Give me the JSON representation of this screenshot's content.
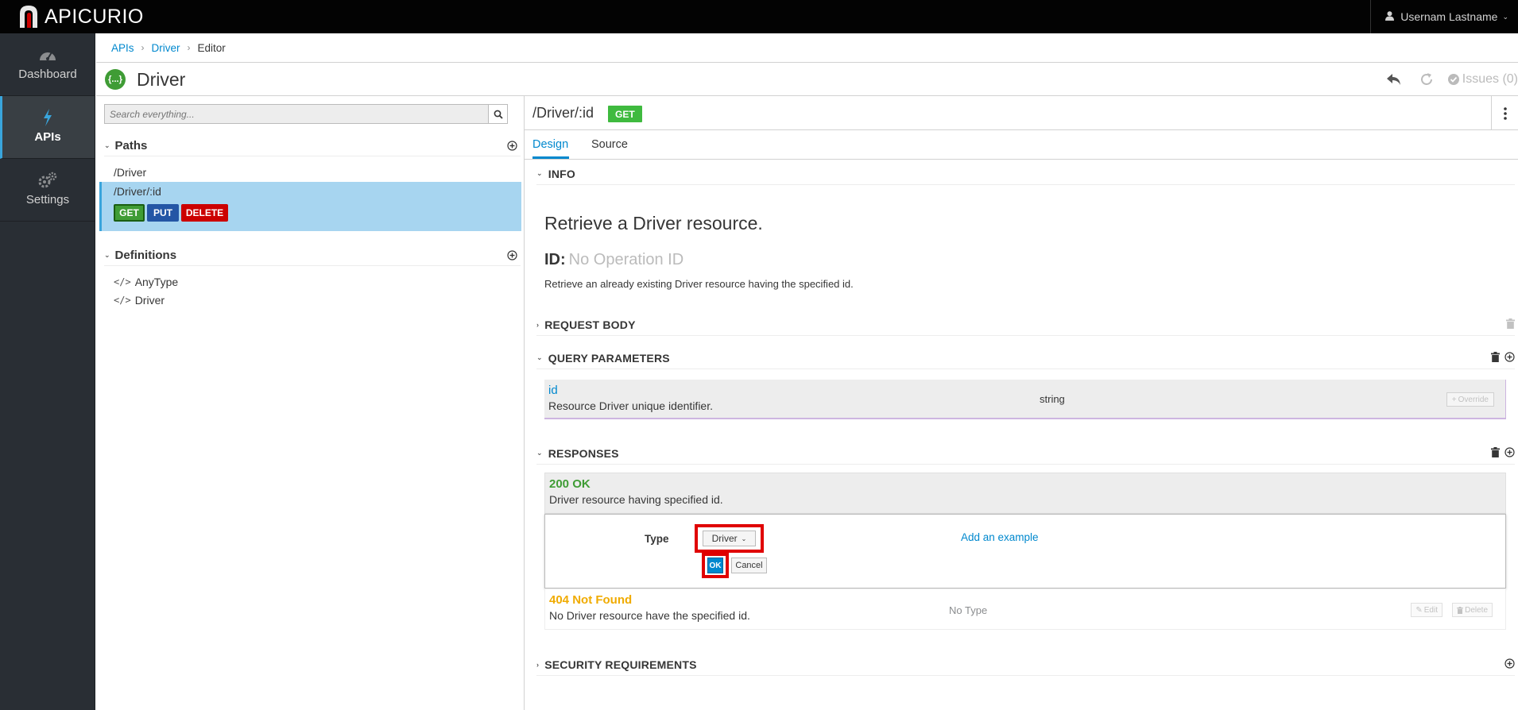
{
  "app": {
    "logo_text": "APICURIO",
    "user": "Usernam Lastname"
  },
  "nav": {
    "items": [
      {
        "label": "Dashboard",
        "icon": "dashboard-icon"
      },
      {
        "label": "APIs",
        "icon": "bolt-icon"
      },
      {
        "label": "Settings",
        "icon": "gears-icon"
      }
    ]
  },
  "breadcrumb": {
    "items": [
      "APIs",
      "Driver",
      "Editor"
    ]
  },
  "header": {
    "icon_text": "{...}",
    "title": "Driver",
    "issues_label": "Issues (0)"
  },
  "left": {
    "search_placeholder": "Search everything...",
    "paths_title": "Paths",
    "paths": [
      "/Driver",
      "/Driver/:id"
    ],
    "operations": [
      "GET",
      "PUT",
      "DELETE"
    ],
    "definitions_title": "Definitions",
    "definitions": [
      "AnyType",
      "Driver"
    ]
  },
  "operation": {
    "path": "/Driver/:id",
    "method": "GET",
    "tabs": [
      "Design",
      "Source"
    ],
    "sections": {
      "info": "INFO",
      "request_body": "REQUEST BODY",
      "query_params": "QUERY PARAMETERS",
      "responses": "RESPONSES",
      "security": "SECURITY REQUIREMENTS"
    },
    "summary": "Retrieve a Driver resource.",
    "id_label": "ID:",
    "id_placeholder": "No Operation ID",
    "description": "Retrieve an already existing Driver resource having the specified id."
  },
  "query_param": {
    "name": "id",
    "description": "Resource Driver unique identifier.",
    "type": "string",
    "override_label": "Override"
  },
  "responses": [
    {
      "code": "200 OK",
      "description": "Driver resource having specified id.",
      "color": "#3f9c35"
    },
    {
      "code": "404 Not Found",
      "description": "No Driver resource have the specified id.",
      "color": "#f0ab00",
      "type": "No Type"
    }
  ],
  "response_editor": {
    "type_label": "Type",
    "type_value": "Driver",
    "ok_label": "OK",
    "cancel_label": "Cancel",
    "add_example_label": "Add an example"
  },
  "response_actions": {
    "edit_label": "Edit",
    "delete_label": "Delete"
  },
  "colors": {
    "accent": "#0088ce",
    "get": "#3f9c35",
    "put": "#2456a5",
    "delete": "#cc0000",
    "highlight": "#e00000"
  }
}
